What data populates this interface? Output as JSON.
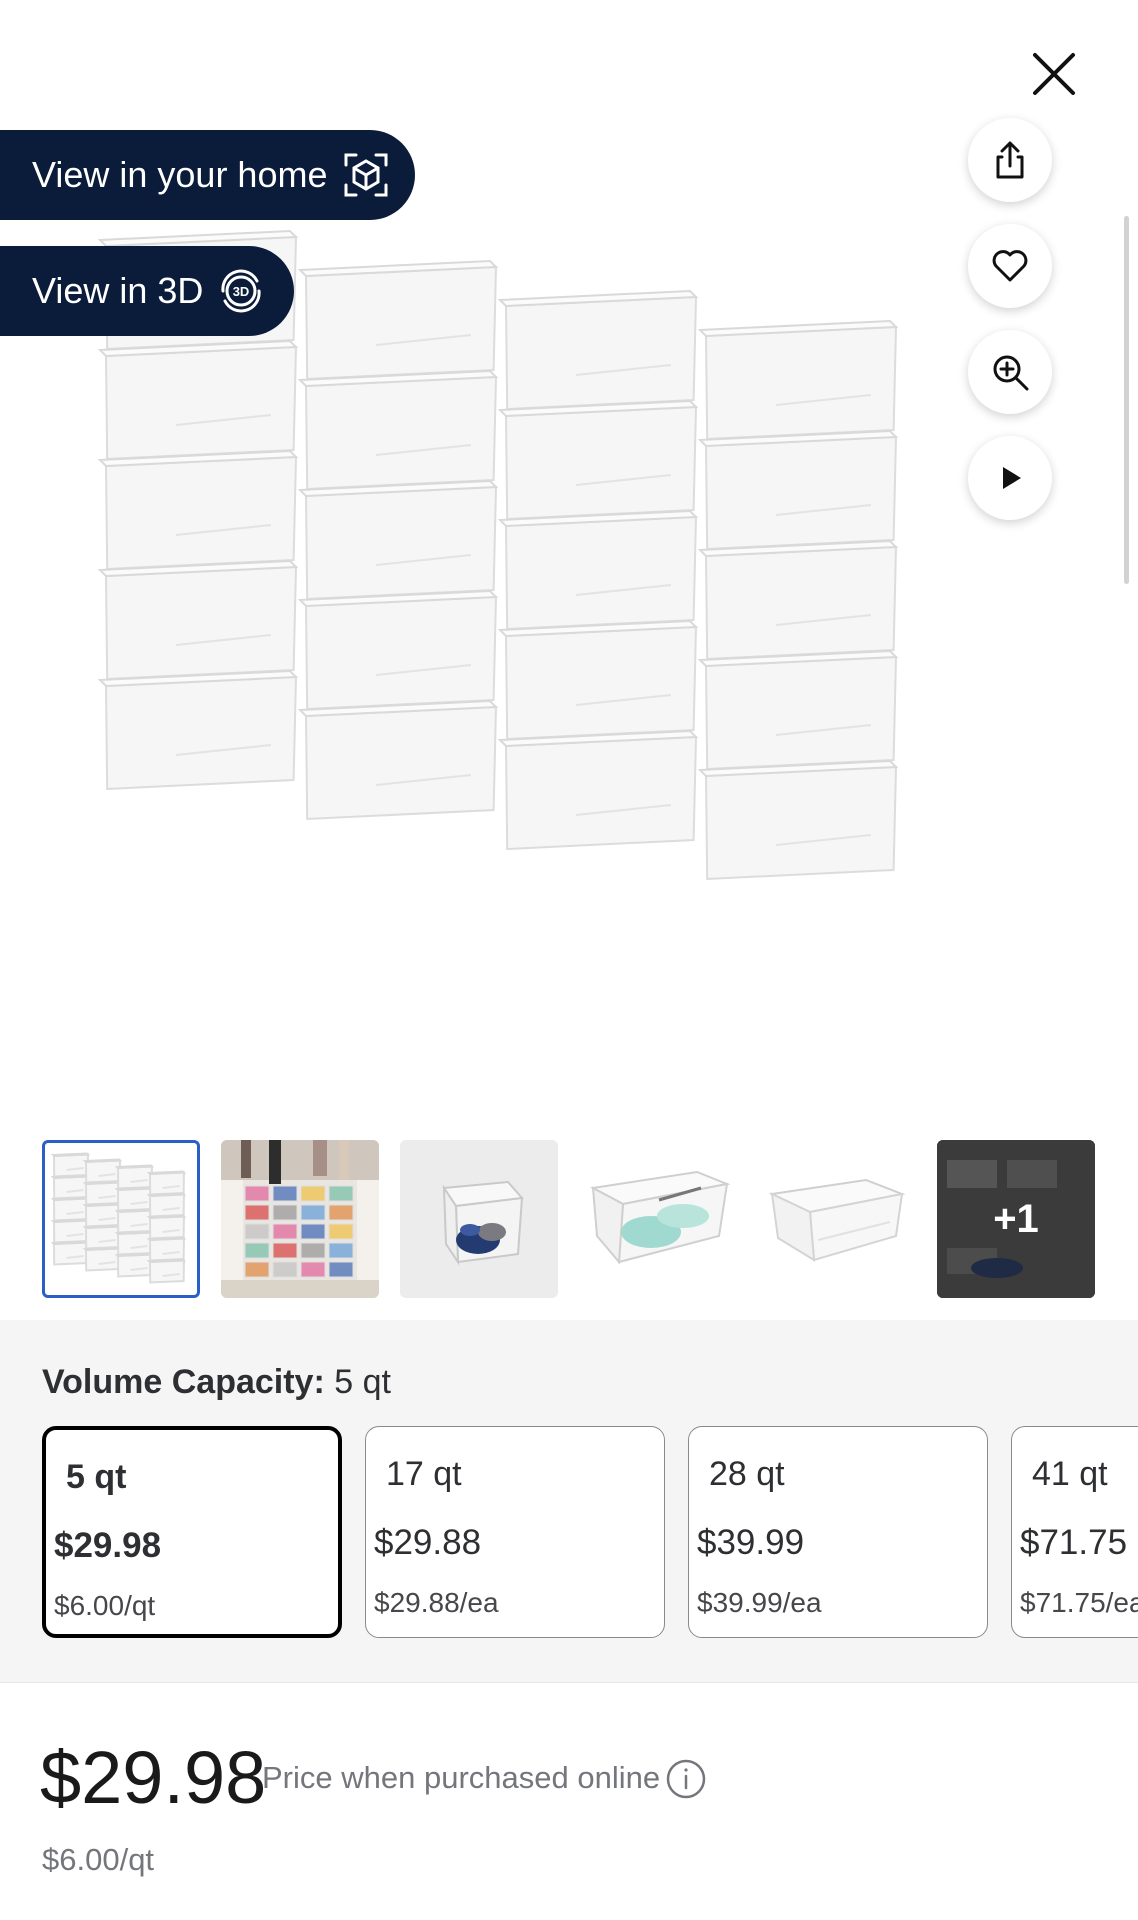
{
  "toolbar": {
    "close_icon": "close-icon",
    "view_home_label": "View in your home",
    "view_home_icon": "ar-cube-icon",
    "view_3d_label": "View in 3D",
    "view_3d_icon": "3d-rotate-icon",
    "side_actions": [
      "share-icon",
      "heart-icon",
      "zoom-in-icon",
      "play-icon"
    ]
  },
  "gallery": {
    "thumbnails": [
      {
        "name": "stacked-clear-boxes",
        "selected": true
      },
      {
        "name": "closet-with-shoe-boxes",
        "selected": false
      },
      {
        "name": "box-with-shoes",
        "selected": false
      },
      {
        "name": "box-with-sneakers",
        "selected": false
      },
      {
        "name": "empty-clear-box",
        "selected": false
      }
    ],
    "more_label": "+1"
  },
  "variant": {
    "label": "Volume Capacity:",
    "selected_value": "5 qt",
    "options": [
      {
        "name": "5 qt",
        "price": "$29.98",
        "unit": "$6.00/qt",
        "selected": true
      },
      {
        "name": "17 qt",
        "price": "$29.88",
        "unit": "$29.88/ea",
        "selected": false
      },
      {
        "name": "28 qt",
        "price": "$39.99",
        "unit": "$39.99/ea",
        "selected": false
      },
      {
        "name": "41 qt",
        "price": "$71.75",
        "unit": "$71.75/ea",
        "selected": false
      }
    ]
  },
  "price": {
    "current": "$29.98",
    "note": "Price when purchased online",
    "unit_price": "$6.00/qt"
  },
  "colors": {
    "pill_bg": "#0b1b3a",
    "selected_thumb_border": "#2a5fc7",
    "variant_bg": "#f5f5f5"
  }
}
